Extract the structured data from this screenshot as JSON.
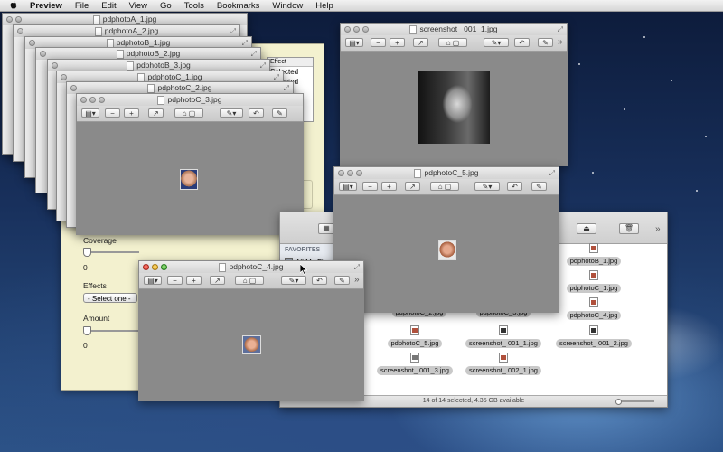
{
  "menubar": {
    "app": "Preview",
    "items": [
      "File",
      "Edit",
      "View",
      "Go",
      "Tools",
      "Bookmarks",
      "Window",
      "Help"
    ]
  },
  "stack_windows": [
    "pdphotoA_1.jpg",
    "pdphotoA_2.jpg",
    "pdphotoB_1.jpg",
    "pdphotoB_2.jpg",
    "pdphotoB_3.jpg",
    "pdphotoC_1.jpg",
    "pdphotoC_2.jpg",
    "pdphotoC_3.jpg"
  ],
  "win_screenshot": {
    "title": "screenshot_ 001_1.jpg"
  },
  "win_c5": {
    "title": "pdphotoC_5.jpg"
  },
  "win_c4": {
    "title": "pdphotoC_4.jpg"
  },
  "toolbar": {
    "more": "»"
  },
  "effect_list": {
    "header": "Effect",
    "rows": [
      "Selected",
      "Selected",
      "ed"
    ]
  },
  "panel": {
    "coverage_label": "Coverage",
    "coverage_value": "0",
    "effects_label": "Effects",
    "effects_select": "- Select one -",
    "amount_label": "Amount",
    "amount_value": "0"
  },
  "finder": {
    "sidebar_header": "FAVORITES",
    "sidebar_item": "All My Files",
    "files": [
      "pdphotoB_1.jpg",
      "pdphotoC_1.jpg",
      "pdphotoC_4.jpg",
      "pdphotoC_2.jpg",
      "pdphotoC_3.jpg",
      "pdphotoC_5.jpg",
      "screenshot_ 001_1.jpg",
      "screenshot_ 001_2.jpg",
      "screenshot_ 001_3.jpg",
      "screenshot_ 002_1.jpg"
    ],
    "status": "14 of 14 selected, 4.35 GB available",
    "more": "»"
  }
}
